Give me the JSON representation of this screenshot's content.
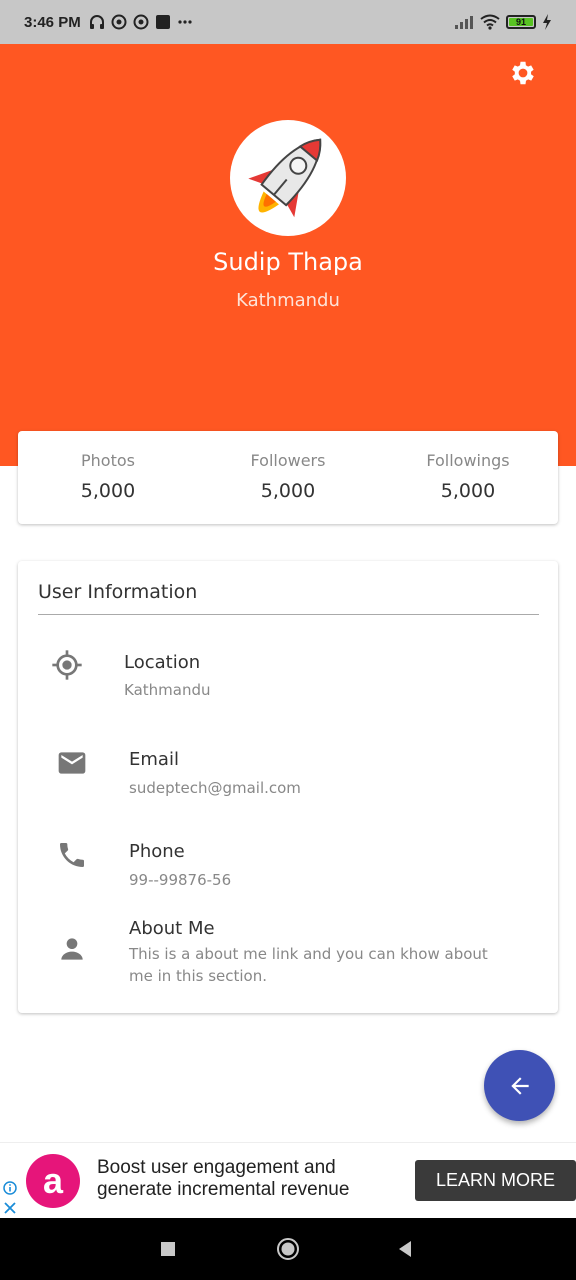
{
  "status_bar": {
    "time": "3:46 PM",
    "battery": "91",
    "battery_level": 0.91,
    "icons_left": [
      "headphones-icon",
      "vpn-icon",
      "vpn-icon",
      "notification-square-icon",
      "more-dots-icon"
    ],
    "icons_right": [
      "signal-icon",
      "wifi-icon",
      "battery-icon",
      "charging-icon"
    ]
  },
  "header": {
    "background": "#ff5722",
    "settings_icon": "gear-icon",
    "name": "Sudip Thapa",
    "city": "Kathmandu"
  },
  "stats": [
    {
      "label": "Photos",
      "value": "5,000"
    },
    {
      "label": "Followers",
      "value": "5,000"
    },
    {
      "label": "Followings",
      "value": "5,000"
    }
  ],
  "user_info": {
    "title": "User Information",
    "items": [
      {
        "icon": "location-target-icon",
        "label": "Location",
        "value": "Kathmandu"
      },
      {
        "icon": "email-icon",
        "label": "Email",
        "value": "sudeptech@gmail.com"
      },
      {
        "icon": "phone-icon",
        "label": "Phone",
        "value": "99--99876-56"
      },
      {
        "icon": "person-icon",
        "label": "About Me",
        "value": "This is a about me link and you can khow about me in this section."
      }
    ]
  },
  "fab": {
    "icon": "arrow-left-icon",
    "color": "#3f51b5"
  },
  "ad": {
    "logo_letter": "a",
    "text": "Boost user engagement and generate incremental revenue",
    "button": "LEARN MORE"
  },
  "nav": {
    "buttons": [
      "recent-apps-icon",
      "home-icon",
      "back-icon"
    ]
  }
}
